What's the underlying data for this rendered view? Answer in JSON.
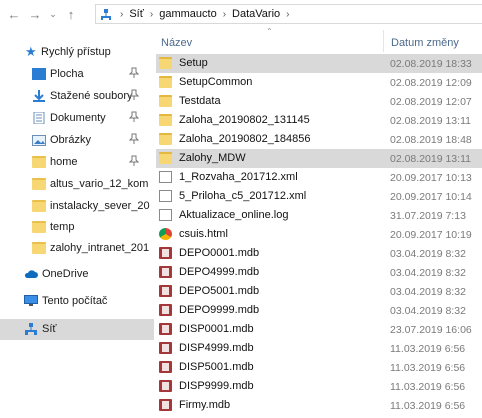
{
  "address": {
    "crumbs": [
      "Síť",
      "gammaucto",
      "DataVario"
    ]
  },
  "columns": {
    "name": "Název",
    "date": "Datum změny"
  },
  "nav": [
    {
      "label": "Rychlý přístup",
      "icon": "star-icon"
    },
    {
      "label": "Plocha",
      "icon": "desktop-icon",
      "pinned": true
    },
    {
      "label": "Stažené soubory",
      "icon": "download-icon",
      "pinned": true
    },
    {
      "label": "Dokumenty",
      "icon": "documents-icon",
      "pinned": true
    },
    {
      "label": "Obrázky",
      "icon": "pictures-icon",
      "pinned": true
    },
    {
      "label": "home",
      "icon": "folder-icon",
      "pinned": true
    },
    {
      "label": "altus_vario_12_kom",
      "icon": "folder-icon"
    },
    {
      "label": "instalacky_sever_20",
      "icon": "folder-icon"
    },
    {
      "label": "temp",
      "icon": "folder-icon"
    },
    {
      "label": "zalohy_intranet_201",
      "icon": "folder-icon"
    },
    {
      "label": "OneDrive",
      "icon": "cloud-icon"
    },
    {
      "label": "Tento počítač",
      "icon": "computer-icon"
    },
    {
      "label": "Síť",
      "icon": "network-icon"
    }
  ],
  "files": [
    {
      "name": "Setup",
      "date": "02.08.2019 18:33",
      "type": "folder"
    },
    {
      "name": "SetupCommon",
      "date": "02.08.2019 12:09",
      "type": "folder"
    },
    {
      "name": "Testdata",
      "date": "02.08.2019 12:07",
      "type": "folder"
    },
    {
      "name": "Zaloha_20190802_131145",
      "date": "02.08.2019 13:11",
      "type": "folder"
    },
    {
      "name": "Zaloha_20190802_184856",
      "date": "02.08.2019 18:48",
      "type": "folder"
    },
    {
      "name": "Zalohy_MDW",
      "date": "02.08.2019 13:11",
      "type": "folder"
    },
    {
      "name": "1_Rozvaha_201712.xml",
      "date": "20.09.2017 10:13",
      "type": "xml"
    },
    {
      "name": "5_Priloha_c5_201712.xml",
      "date": "20.09.2017 10:14",
      "type": "xml"
    },
    {
      "name": "Aktualizace_online.log",
      "date": "31.07.2019 7:13",
      "type": "log"
    },
    {
      "name": "csuis.html",
      "date": "20.09.2017 10:19",
      "type": "html"
    },
    {
      "name": "DEPO0001.mdb",
      "date": "03.04.2019 8:32",
      "type": "mdb"
    },
    {
      "name": "DEPO4999.mdb",
      "date": "03.04.2019 8:32",
      "type": "mdb"
    },
    {
      "name": "DEPO5001.mdb",
      "date": "03.04.2019 8:32",
      "type": "mdb"
    },
    {
      "name": "DEPO9999.mdb",
      "date": "03.04.2019 8:32",
      "type": "mdb"
    },
    {
      "name": "DISP0001.mdb",
      "date": "23.07.2019 16:06",
      "type": "mdb"
    },
    {
      "name": "DISP4999.mdb",
      "date": "11.03.2019 6:56",
      "type": "mdb"
    },
    {
      "name": "DISP5001.mdb",
      "date": "11.03.2019 6:56",
      "type": "mdb"
    },
    {
      "name": "DISP9999.mdb",
      "date": "11.03.2019 6:56",
      "type": "mdb"
    },
    {
      "name": "Firmy.mdb",
      "date": "11.03.2019 6:56",
      "type": "mdb"
    }
  ],
  "colors": {
    "selection": "#cce8ff",
    "hover": "#d9d9d9",
    "header_text": "#4c6a8c",
    "date_text": "#7a7a7a"
  }
}
